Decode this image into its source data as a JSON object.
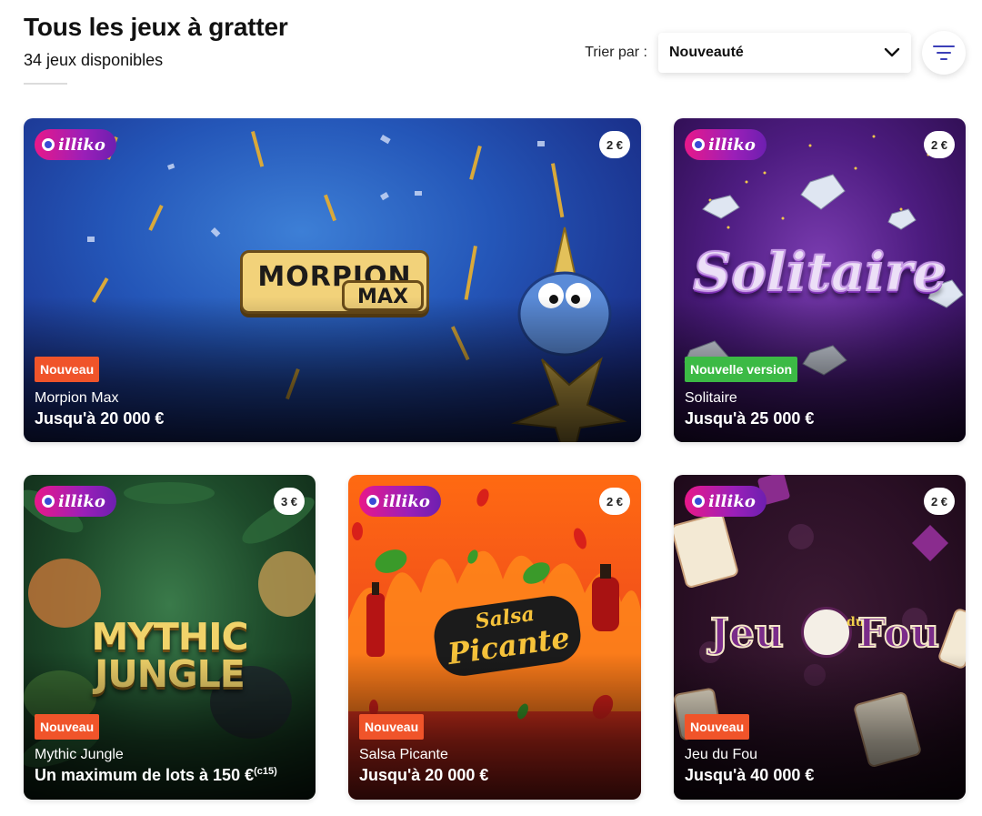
{
  "header": {
    "title": "Tous les jeux à gratter",
    "subtitle": "34 jeux disponibles"
  },
  "sort": {
    "label": "Trier par :",
    "value": "Nouveauté"
  },
  "brand_name": "illiko",
  "games": [
    {
      "name": "Morpion Max",
      "price": "2 €",
      "badge": "Nouveau",
      "prize": "Jusqu'à 20 000 €",
      "logo_line1": "MORPION",
      "logo_line2": "MAX"
    },
    {
      "name": "Solitaire",
      "price": "2 €",
      "badge": "Nouvelle version",
      "prize": "Jusqu'à 25 000 €",
      "logo_line1": "Solitaire"
    },
    {
      "name": "Mythic Jungle",
      "price": "3 €",
      "badge": "Nouveau",
      "prize": "Un maximum de lots à 150 €",
      "prize_note": "(c15)",
      "logo_line1": "MYTHIC JUNGLE"
    },
    {
      "name": "Salsa Picante",
      "price": "2 €",
      "badge": "Nouveau",
      "prize": "Jusqu'à 20 000 €",
      "logo_line1": "Salsa",
      "logo_line2": "Picante"
    },
    {
      "name": "Jeu du Fou",
      "price": "2 €",
      "badge": "Nouveau",
      "prize": "Jusqu'à 40 000 €",
      "logo_line1": "Jeu",
      "logo_line2": "du",
      "logo_line3": "Fou"
    }
  ]
}
